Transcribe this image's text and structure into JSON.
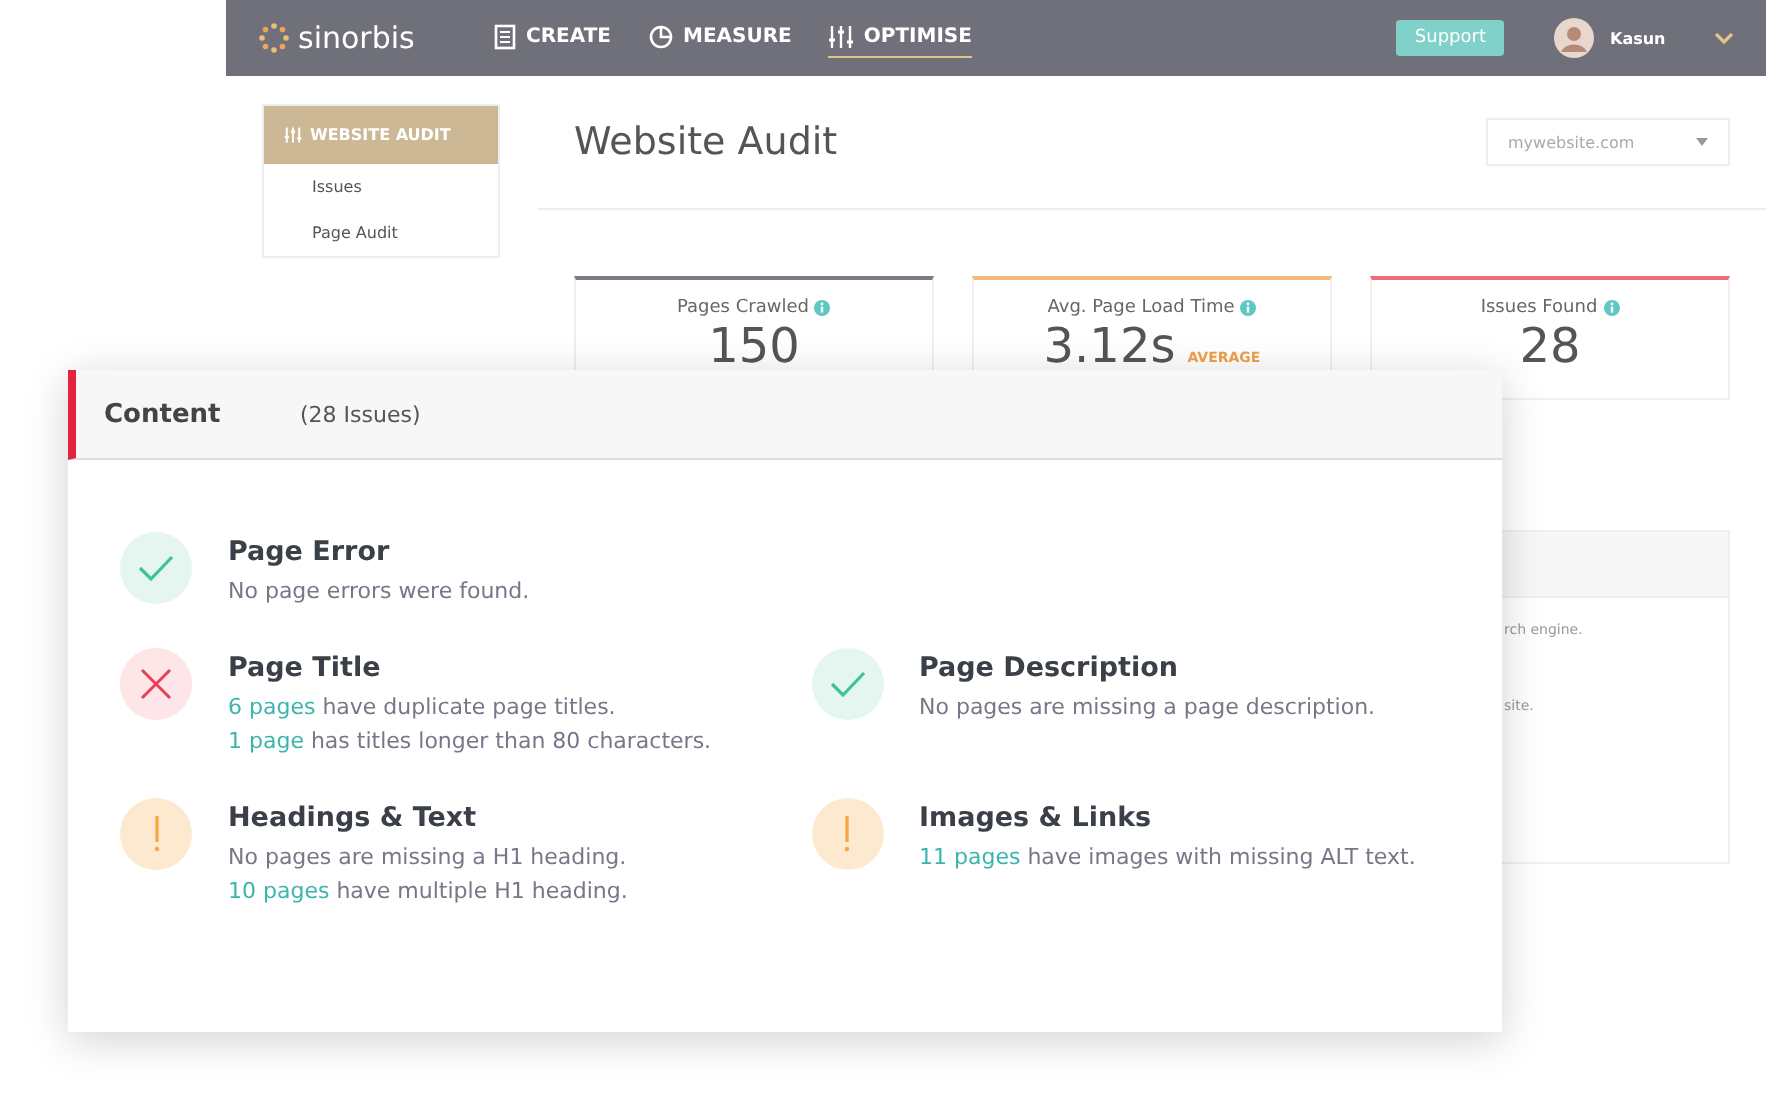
{
  "topbar": {
    "logo": "sinorbis",
    "nav": [
      {
        "label": "CREATE",
        "kind": "document",
        "selected": false
      },
      {
        "label": "MEASURE",
        "kind": "chart",
        "selected": false
      },
      {
        "label": "OPTIMISE",
        "kind": "sliders",
        "selected": true
      }
    ],
    "support_button": "Support",
    "user": "Kasun"
  },
  "sidebar": {
    "items": [
      {
        "label": "WEBSITE AUDIT",
        "selected": true
      },
      {
        "label": "Issues",
        "selected": false
      },
      {
        "label": "Page Audit",
        "selected": false
      }
    ]
  },
  "page_title": "Website Audit",
  "site_select": {
    "value": "mywebsite.com"
  },
  "stats": [
    {
      "label": "Pages Crawled",
      "value": "150",
      "color": "#7a7c84"
    },
    {
      "label": "Avg. Page Load Time",
      "value": "3.12s",
      "badge": "AVERAGE",
      "color": "#f5b97a"
    },
    {
      "label": "Issues Found",
      "value": "28",
      "color": "#ee6a7c"
    }
  ],
  "background_panel": {
    "lines": [
      "rch engine.",
      "site."
    ]
  },
  "content_card": {
    "title": "Content",
    "count": "(28 Issues)",
    "rows": [
      [
        {
          "kind": "pass",
          "title": "Page Error",
          "lines": [
            {
              "text": "No page errors were found."
            }
          ]
        }
      ],
      [
        {
          "kind": "fail",
          "title": "Page Title",
          "lines": [
            {
              "link": "6 pages",
              "text": " have duplicate page titles."
            },
            {
              "link": "1 page",
              "text": " has titles longer than 80 characters."
            }
          ]
        },
        {
          "kind": "pass",
          "title": "Page Description",
          "lines": [
            {
              "text": "No pages are missing a page description."
            }
          ]
        }
      ],
      [
        {
          "kind": "warning",
          "title": "Headings & Text",
          "lines": [
            {
              "text": "No pages are missing a H1 heading."
            },
            {
              "link": "10 pages",
              "text": " have multiple H1 heading."
            }
          ]
        },
        {
          "kind": "warning",
          "title": "Images & Links",
          "lines": [
            {
              "link": "11 pages",
              "text": " have images with missing ALT text."
            }
          ]
        }
      ]
    ]
  }
}
